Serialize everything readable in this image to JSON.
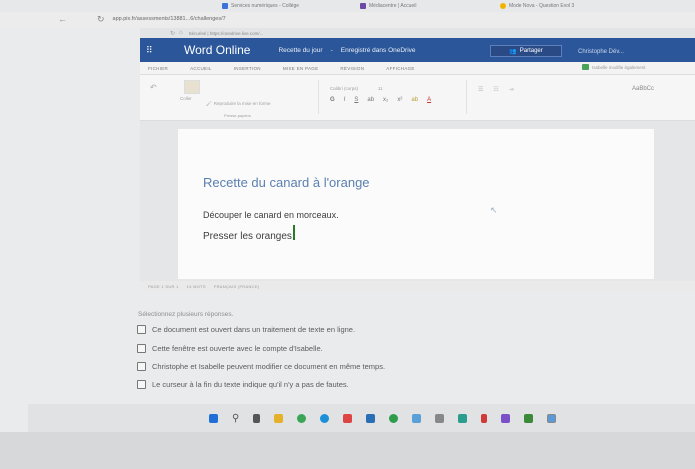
{
  "browser": {
    "tabs": [
      {
        "label": "Services numériques - Collège",
        "color": "#3d73d8"
      },
      {
        "label": "Médiacentre | Accueil",
        "color": "#6b4aa6"
      },
      {
        "label": "Mode Nova - Question Evol 3",
        "color": "#f2b300"
      }
    ],
    "url": "app.pix.fr/assessments/13881...6/challenges/7"
  },
  "inner_browser": {
    "url": "Sécurisé | https://onedrive.live.com/..."
  },
  "word": {
    "app_name": "Word Online",
    "doc_name": "Recette du jour",
    "separator": "-",
    "save_status": "Enregistré dans OneDrive",
    "share_label": "Partager",
    "user_name": "Christophe Dév...",
    "ribbon_tabs": [
      "FICHIER",
      "ACCUEIL",
      "INSERTION",
      "MISE EN PAGE",
      "RÉVISION",
      "AFFICHAGE"
    ],
    "ribbon_user": "Isabelle modifie également",
    "ribbon": {
      "paste_label": "Coller",
      "clipboard_group": "Presse-papiers",
      "format_painter": "Reproduire la mise en forme",
      "font_name": "Calibri (corps)",
      "font_size": "11",
      "styles_label": "AaBbCc"
    },
    "document": {
      "title": "Recette du canard à l'orange",
      "paragraph_1": "Découper le canard en morceaux.",
      "paragraph_2": "Presser les oranges"
    },
    "status": {
      "page": "PAGE 1 SUR 1",
      "words": "14 MOTS",
      "language": "FRANÇAIS (FRANCE)"
    }
  },
  "quiz": {
    "prompt": "Sélectionnez plusieurs réponses.",
    "options": [
      "Ce document est ouvert dans un traitement de texte en ligne.",
      "Cette fenêtre est ouverte avec le compte d'Isabelle.",
      "Christophe et Isabelle peuvent modifier ce document en même temps.",
      "Le curseur à la fin du texte indique qu'il n'y a pas de fautes."
    ]
  },
  "taskbar_colors": {
    "start": "#1f6fd6",
    "explorer": "#e6b02a",
    "chrome": "#3aa655",
    "edge": "#1c8fd9",
    "store": "#d44",
    "mail": "#2a6fb5",
    "green": "#2e9c4a",
    "red": "#d23a3a",
    "teal": "#2a9d8f",
    "purple": "#7a4fc8"
  }
}
